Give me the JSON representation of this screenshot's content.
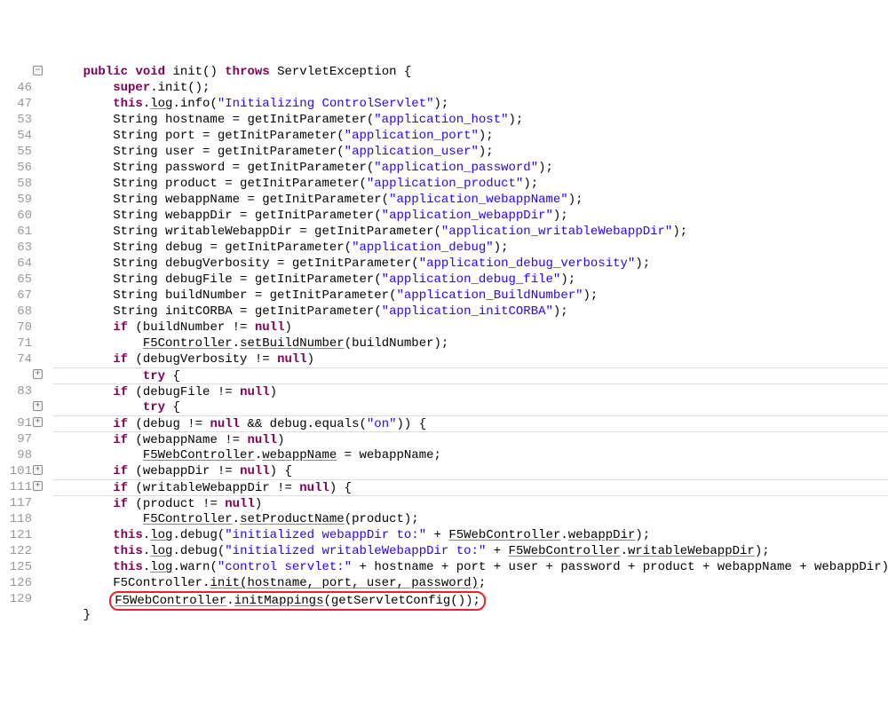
{
  "lines": [
    {
      "num": "",
      "fold": "minus",
      "indent": 4,
      "tokens": [
        {
          "t": "kw",
          "v": "public"
        },
        {
          "t": "sp"
        },
        {
          "t": "kw",
          "v": "void"
        },
        {
          "t": "sp"
        },
        {
          "t": "id",
          "v": "init() "
        },
        {
          "t": "kw",
          "v": "throws"
        },
        {
          "t": "id",
          "v": " ServletException {"
        }
      ]
    },
    {
      "num": "46",
      "indent": 8,
      "tokens": [
        {
          "t": "kw",
          "v": "super"
        },
        {
          "t": "id",
          "v": ".init();"
        }
      ]
    },
    {
      "num": "47",
      "indent": 8,
      "tokens": [
        {
          "t": "kw",
          "v": "this"
        },
        {
          "t": "id",
          "v": "."
        },
        {
          "t": "ul",
          "v": "log"
        },
        {
          "t": "id",
          "v": ".info("
        },
        {
          "t": "str",
          "v": "\"Initializing ControlServlet\""
        },
        {
          "t": "id",
          "v": ");"
        }
      ]
    },
    {
      "num": "53",
      "indent": 8,
      "tokens": [
        {
          "t": "id",
          "v": "String hostname = getInitParameter("
        },
        {
          "t": "str",
          "v": "\"application_host\""
        },
        {
          "t": "id",
          "v": ");"
        }
      ]
    },
    {
      "num": "54",
      "indent": 8,
      "tokens": [
        {
          "t": "id",
          "v": "String port = getInitParameter("
        },
        {
          "t": "str",
          "v": "\"application_port\""
        },
        {
          "t": "id",
          "v": ");"
        }
      ]
    },
    {
      "num": "55",
      "indent": 8,
      "tokens": [
        {
          "t": "id",
          "v": "String user = getInitParameter("
        },
        {
          "t": "str",
          "v": "\"application_user\""
        },
        {
          "t": "id",
          "v": ");"
        }
      ]
    },
    {
      "num": "56",
      "indent": 8,
      "tokens": [
        {
          "t": "id",
          "v": "String password = getInitParameter("
        },
        {
          "t": "str",
          "v": "\"application_password\""
        },
        {
          "t": "id",
          "v": ");"
        }
      ]
    },
    {
      "num": "58",
      "indent": 8,
      "tokens": [
        {
          "t": "id",
          "v": "String product = getInitParameter("
        },
        {
          "t": "str",
          "v": "\"application_product\""
        },
        {
          "t": "id",
          "v": ");"
        }
      ]
    },
    {
      "num": "59",
      "indent": 8,
      "tokens": [
        {
          "t": "id",
          "v": "String webappName = getInitParameter("
        },
        {
          "t": "str",
          "v": "\"application_webappName\""
        },
        {
          "t": "id",
          "v": ");"
        }
      ]
    },
    {
      "num": "60",
      "indent": 8,
      "tokens": [
        {
          "t": "id",
          "v": "String webappDir = getInitParameter("
        },
        {
          "t": "str",
          "v": "\"application_webappDir\""
        },
        {
          "t": "id",
          "v": ");"
        }
      ]
    },
    {
      "num": "61",
      "indent": 8,
      "tokens": [
        {
          "t": "id",
          "v": "String writableWebappDir = getInitParameter("
        },
        {
          "t": "str",
          "v": "\"application_writableWebappDir\""
        },
        {
          "t": "id",
          "v": ");"
        }
      ]
    },
    {
      "num": "63",
      "indent": 8,
      "tokens": [
        {
          "t": "id",
          "v": "String debug = getInitParameter("
        },
        {
          "t": "str",
          "v": "\"application_debug\""
        },
        {
          "t": "id",
          "v": ");"
        }
      ]
    },
    {
      "num": "64",
      "indent": 8,
      "tokens": [
        {
          "t": "id",
          "v": "String debugVerbosity = getInitParameter("
        },
        {
          "t": "str",
          "v": "\"application_debug_verbosity\""
        },
        {
          "t": "id",
          "v": ");"
        }
      ]
    },
    {
      "num": "65",
      "indent": 8,
      "tokens": [
        {
          "t": "id",
          "v": "String debugFile = getInitParameter("
        },
        {
          "t": "str",
          "v": "\"application_debug_file\""
        },
        {
          "t": "id",
          "v": ");"
        }
      ]
    },
    {
      "num": "67",
      "indent": 8,
      "tokens": [
        {
          "t": "id",
          "v": "String buildNumber = getInitParameter("
        },
        {
          "t": "str",
          "v": "\"application_BuildNumber\""
        },
        {
          "t": "id",
          "v": ");"
        }
      ]
    },
    {
      "num": "68",
      "indent": 8,
      "tokens": [
        {
          "t": "id",
          "v": "String initCORBA = getInitParameter("
        },
        {
          "t": "str",
          "v": "\"application_initCORBA\""
        },
        {
          "t": "id",
          "v": ");"
        }
      ]
    },
    {
      "num": "70",
      "indent": 8,
      "tokens": [
        {
          "t": "kw",
          "v": "if"
        },
        {
          "t": "id",
          "v": " (buildNumber != "
        },
        {
          "t": "kw",
          "v": "null"
        },
        {
          "t": "id",
          "v": ")"
        }
      ]
    },
    {
      "num": "71",
      "indent": 12,
      "tokens": [
        {
          "t": "ul",
          "v": "F5Controller"
        },
        {
          "t": "id",
          "v": "."
        },
        {
          "t": "ul",
          "v": "setBuildNumber"
        },
        {
          "t": "id",
          "v": "(buildNumber);"
        }
      ]
    },
    {
      "num": "74",
      "indent": 8,
      "tokens": [
        {
          "t": "kw",
          "v": "if"
        },
        {
          "t": "id",
          "v": " (debugVerbosity != "
        },
        {
          "t": "kw",
          "v": "null"
        },
        {
          "t": "id",
          "v": ")"
        }
      ]
    },
    {
      "num": "",
      "fold": "plus",
      "indent": 12,
      "divider": true,
      "tokens": [
        {
          "t": "kw",
          "v": "try"
        },
        {
          "t": "id",
          "v": " {"
        }
      ]
    },
    {
      "num": "83",
      "indent": 8,
      "divider": true,
      "tokens": [
        {
          "t": "kw",
          "v": "if"
        },
        {
          "t": "id",
          "v": " (debugFile != "
        },
        {
          "t": "kw",
          "v": "null"
        },
        {
          "t": "id",
          "v": ")"
        }
      ]
    },
    {
      "num": "",
      "fold": "plus",
      "indent": 12,
      "tokens": [
        {
          "t": "kw",
          "v": "try"
        },
        {
          "t": "id",
          "v": " {"
        }
      ]
    },
    {
      "num": "91",
      "fold": "plus",
      "indent": 8,
      "divider": true,
      "tokens": [
        {
          "t": "kw",
          "v": "if"
        },
        {
          "t": "id",
          "v": " (debug != "
        },
        {
          "t": "kw",
          "v": "null"
        },
        {
          "t": "id",
          "v": " && debug.equals("
        },
        {
          "t": "str",
          "v": "\"on\""
        },
        {
          "t": "id",
          "v": ")) {"
        }
      ]
    },
    {
      "num": "97",
      "indent": 8,
      "divider": true,
      "tokens": [
        {
          "t": "kw",
          "v": "if"
        },
        {
          "t": "id",
          "v": " (webappName != "
        },
        {
          "t": "kw",
          "v": "null"
        },
        {
          "t": "id",
          "v": ")"
        }
      ]
    },
    {
      "num": "98",
      "indent": 12,
      "tokens": [
        {
          "t": "ul",
          "v": "F5WebController"
        },
        {
          "t": "id",
          "v": "."
        },
        {
          "t": "ul",
          "v": "webappName"
        },
        {
          "t": "id",
          "v": " = webappName;"
        }
      ]
    },
    {
      "num": "101",
      "fold": "plus",
      "indent": 8,
      "tokens": [
        {
          "t": "kw",
          "v": "if"
        },
        {
          "t": "id",
          "v": " (webappDir != "
        },
        {
          "t": "kw",
          "v": "null"
        },
        {
          "t": "id",
          "v": ") {"
        }
      ]
    },
    {
      "num": "111",
      "fold": "plus",
      "indent": 8,
      "divider": true,
      "tokens": [
        {
          "t": "kw",
          "v": "if"
        },
        {
          "t": "id",
          "v": " (writableWebappDir != "
        },
        {
          "t": "kw",
          "v": "null"
        },
        {
          "t": "id",
          "v": ") {"
        }
      ]
    },
    {
      "num": "117",
      "indent": 8,
      "divider": true,
      "tokens": [
        {
          "t": "kw",
          "v": "if"
        },
        {
          "t": "id",
          "v": " (product != "
        },
        {
          "t": "kw",
          "v": "null"
        },
        {
          "t": "id",
          "v": ")"
        }
      ]
    },
    {
      "num": "118",
      "indent": 12,
      "tokens": [
        {
          "t": "ul",
          "v": "F5Controller"
        },
        {
          "t": "id",
          "v": "."
        },
        {
          "t": "ul",
          "v": "setProductName"
        },
        {
          "t": "id",
          "v": "(product);"
        }
      ]
    },
    {
      "num": "121",
      "indent": 8,
      "tokens": [
        {
          "t": "kw",
          "v": "this"
        },
        {
          "t": "id",
          "v": "."
        },
        {
          "t": "ul",
          "v": "log"
        },
        {
          "t": "id",
          "v": ".debug("
        },
        {
          "t": "str",
          "v": "\"initialized webappDir to:\""
        },
        {
          "t": "id",
          "v": " + "
        },
        {
          "t": "ul",
          "v": "F5WebController"
        },
        {
          "t": "id",
          "v": "."
        },
        {
          "t": "ul",
          "v": "webappDir"
        },
        {
          "t": "id",
          "v": ");"
        }
      ]
    },
    {
      "num": "122",
      "indent": 8,
      "tokens": [
        {
          "t": "kw",
          "v": "this"
        },
        {
          "t": "id",
          "v": "."
        },
        {
          "t": "ul",
          "v": "log"
        },
        {
          "t": "id",
          "v": ".debug("
        },
        {
          "t": "str",
          "v": "\"initialized writableWebappDir to:\""
        },
        {
          "t": "id",
          "v": " + "
        },
        {
          "t": "ul",
          "v": "F5WebController"
        },
        {
          "t": "id",
          "v": "."
        },
        {
          "t": "ul",
          "v": "writableWebappDir"
        },
        {
          "t": "id",
          "v": ");"
        }
      ]
    },
    {
      "num": "125",
      "indent": 8,
      "tokens": [
        {
          "t": "kw",
          "v": "this"
        },
        {
          "t": "id",
          "v": "."
        },
        {
          "t": "ul",
          "v": "log"
        },
        {
          "t": "id",
          "v": ".warn("
        },
        {
          "t": "str",
          "v": "\"control servlet:\""
        },
        {
          "t": "id",
          "v": " + hostname + port + user + password + product + webappName + webappDir);"
        }
      ]
    },
    {
      "num": "126",
      "indent": 8,
      "tokens": [
        {
          "t": "id",
          "v": "F5Controller."
        },
        {
          "t": "ul",
          "v": "init(hostname, port, user, password)"
        },
        {
          "t": "id",
          "v": ";"
        }
      ]
    },
    {
      "num": "129",
      "indent": 8,
      "highlight": true,
      "tokens": [
        {
          "t": "ul",
          "v": "F5WebController"
        },
        {
          "t": "id",
          "v": "."
        },
        {
          "t": "ul",
          "v": "initMappings"
        },
        {
          "t": "id",
          "v": "(getServletConfig());"
        }
      ]
    },
    {
      "num": "",
      "indent": 4,
      "tokens": [
        {
          "t": "id",
          "v": "}"
        }
      ]
    }
  ],
  "fold_glyphs": {
    "plus": "+",
    "minus": "−"
  }
}
